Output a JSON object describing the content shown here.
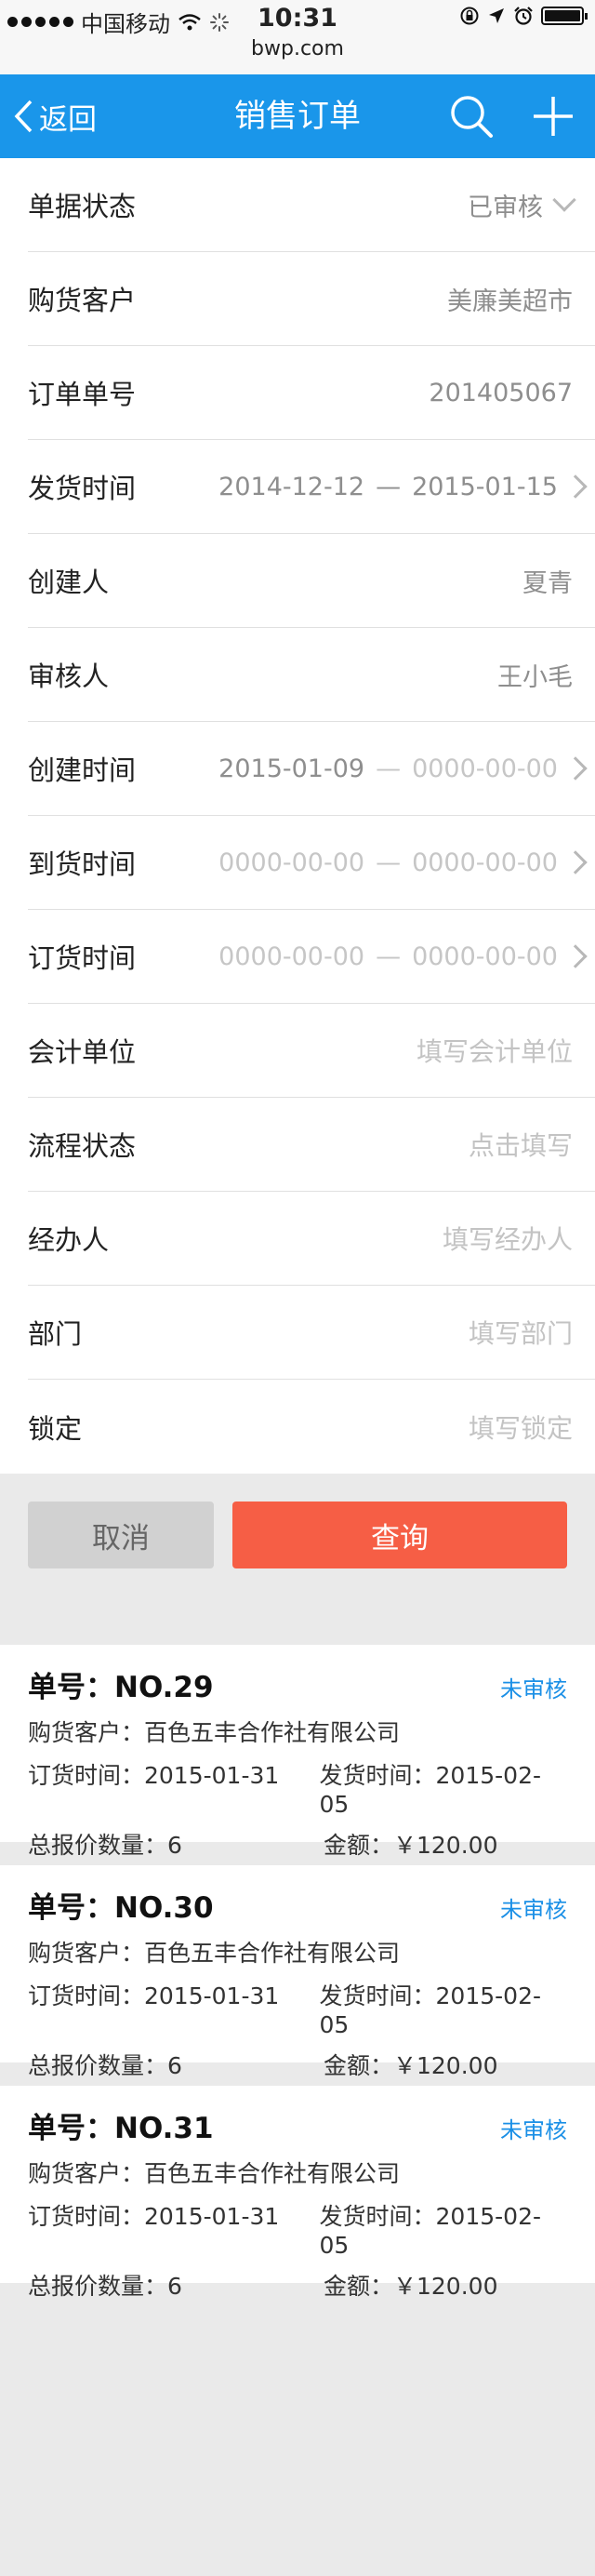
{
  "statusbar": {
    "carrier": "中国移动",
    "time": "10:31",
    "url": "bwp.com"
  },
  "nav": {
    "back_label": "返回",
    "title": "销售订单",
    "search_icon": "search-icon",
    "add_icon": "plus-icon",
    "color": "#1a96ea"
  },
  "form": {
    "status": {
      "label": "单据状态",
      "value": "已审核"
    },
    "customer": {
      "label": "购货客户",
      "value": "美廉美超市"
    },
    "order_no": {
      "label": "订单单号",
      "value": "201405067"
    },
    "ship_time": {
      "label": "发货时间",
      "from": "2014-12-12",
      "to": "2015-01-15",
      "sep": "—"
    },
    "creator": {
      "label": "创建人",
      "value": "夏青"
    },
    "auditor": {
      "label": "审核人",
      "value": "王小毛"
    },
    "create_time": {
      "label": "创建时间",
      "from": "2015-01-09",
      "to": "0000-00-00",
      "sep": "—"
    },
    "arrive_time": {
      "label": "到货时间",
      "from": "0000-00-00",
      "to": "0000-00-00",
      "sep": "—"
    },
    "order_time": {
      "label": "订货时间",
      "from": "0000-00-00",
      "to": "0000-00-00",
      "sep": "—"
    },
    "account_unit": {
      "label": "会计单位",
      "placeholder": "填写会计单位"
    },
    "flow_status": {
      "label": "流程状态",
      "placeholder": "点击填写"
    },
    "handler": {
      "label": "经办人",
      "placeholder": "填写经办人"
    },
    "department": {
      "label": "部门",
      "placeholder": "填写部门"
    },
    "lock": {
      "label": "锁定",
      "placeholder": "填写锁定"
    }
  },
  "buttons": {
    "cancel": "取消",
    "query": "查询",
    "query_color": "#f65e45"
  },
  "orders": [
    {
      "no": "单号：NO.29",
      "status": "未审核",
      "customer": "购货客户：百色五丰合作社有限公司",
      "order_time": "订货时间：2015-01-31",
      "ship_time": "发货时间：2015-02-05",
      "quantity": "总报价数量：6",
      "amount": "金额：￥120.00"
    },
    {
      "no": "单号：NO.30",
      "status": "未审核",
      "customer": "购货客户：百色五丰合作社有限公司",
      "order_time": "订货时间：2015-01-31",
      "ship_time": "发货时间：2015-02-05",
      "quantity": "总报价数量：6",
      "amount": "金额：￥120.00"
    },
    {
      "no": "单号：NO.31",
      "status": "未审核",
      "customer": "购货客户：百色五丰合作社有限公司",
      "order_time": "订货时间：2015-01-31",
      "ship_time": "发货时间：2015-02-05",
      "quantity": "总报价数量：6",
      "amount": "金额：￥120.00"
    }
  ]
}
